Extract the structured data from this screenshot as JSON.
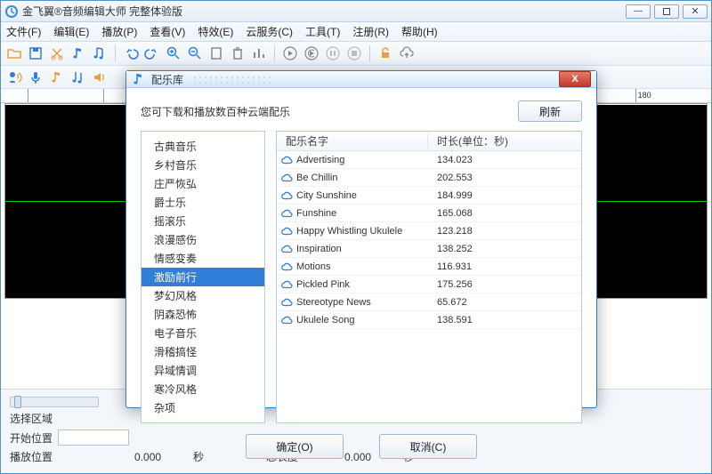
{
  "window": {
    "title": "金飞翼®音频编辑大师 完整体验版"
  },
  "menu": {
    "file": "文件(F)",
    "edit": "编辑(E)",
    "play": "播放(P)",
    "view": "查看(V)",
    "effect": "特效(E)",
    "cloud": "云服务(C)",
    "tools": "工具(T)",
    "register": "注册(R)",
    "help": "帮助(H)"
  },
  "ruler": {
    "end_tick": "180"
  },
  "status": {
    "select_region": "选择区域",
    "start_pos": "开始位置",
    "play_pos": "播放位置",
    "total_len": "总长度",
    "zero": "0.000",
    "sec": "秒"
  },
  "dialog": {
    "title": "配乐库",
    "hint": "您可下载和播放数百种云端配乐",
    "refresh": "刷新",
    "ok": "确定(O)",
    "cancel": "取消(C)",
    "col_name": "配乐名字",
    "col_dur": "时长(单位：秒)",
    "categories": [
      "古典音乐",
      "乡村音乐",
      "庄严恢弘",
      "爵士乐",
      "摇滚乐",
      "浪漫感伤",
      "情感变奏",
      "激励前行",
      "梦幻风格",
      "阴森恐怖",
      "电子音乐",
      "滑稽搞怪",
      "异域情调",
      "寒冷风格",
      "杂项"
    ],
    "selected_category_index": 7,
    "songs": [
      {
        "name": "Advertising",
        "dur": "134.023"
      },
      {
        "name": "Be Chillin",
        "dur": "202.553"
      },
      {
        "name": "City Sunshine",
        "dur": "184.999"
      },
      {
        "name": "Funshine",
        "dur": "165.068"
      },
      {
        "name": "Happy Whistling Ukulele",
        "dur": "123.218"
      },
      {
        "name": "Inspiration",
        "dur": "138.252"
      },
      {
        "name": "Motions",
        "dur": "116.931"
      },
      {
        "name": "Pickled Pink",
        "dur": "175.256"
      },
      {
        "name": "Stereotype News",
        "dur": "65.672"
      },
      {
        "name": "Ukulele Song",
        "dur": "138.591"
      }
    ]
  },
  "colors": {
    "accent": "#2f7ed8",
    "close_red": "#c33a2a"
  }
}
